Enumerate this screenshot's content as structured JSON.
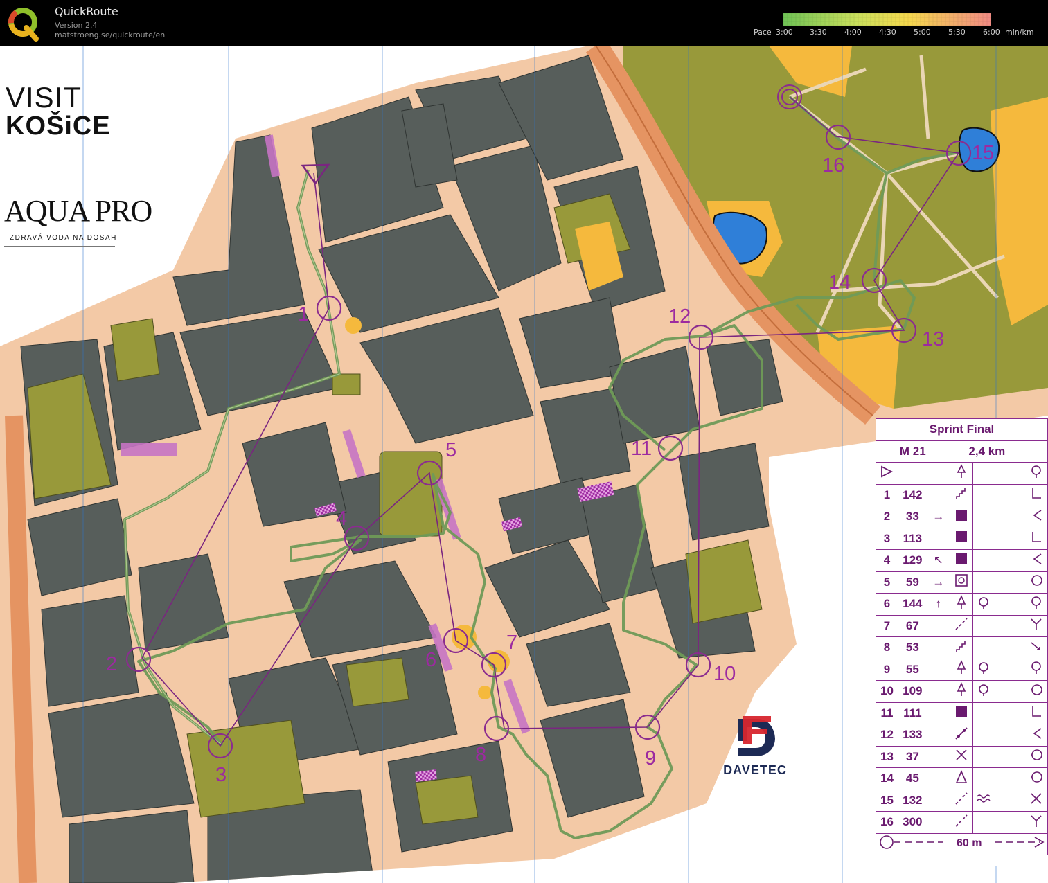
{
  "app": {
    "name": "QuickRoute",
    "version": "Version 2.4",
    "url": "matstroeng.se/quickroute/en"
  },
  "pace_scale": {
    "label": "Pace",
    "ticks": [
      "3:00",
      "3:30",
      "4:00",
      "4:30",
      "5:00",
      "5:30",
      "6:00"
    ],
    "unit": "min/km",
    "colors": [
      "#6fc255",
      "#d9e35c",
      "#f5d84e",
      "#f08a84"
    ]
  },
  "sponsors": {
    "visit_line1": "VISIT",
    "visit_line2": "KOŠiCE",
    "aquapro_name": "AQUA PRO",
    "aquapro_tagline": "ZDRAVÁ VODA NA DOSAH",
    "davetec_name": "DAVETEC"
  },
  "map": {
    "colors": {
      "building": "#575e5b",
      "paved": "#f3c9a6",
      "vegetation": "#98993a",
      "open_yellow": "#f5b93d",
      "water": "#2f7fd8",
      "course": "#8b2c8f",
      "route": "#6f9a57",
      "magnetic_north": "#2c73cc"
    },
    "controls": [
      {
        "label": "1"
      },
      {
        "label": "2"
      },
      {
        "label": "3"
      },
      {
        "label": "4"
      },
      {
        "label": "5"
      },
      {
        "label": "6"
      },
      {
        "label": "7"
      },
      {
        "label": "8"
      },
      {
        "label": "9"
      },
      {
        "label": "10"
      },
      {
        "label": "11"
      },
      {
        "label": "12"
      },
      {
        "label": "13"
      },
      {
        "label": "14"
      },
      {
        "label": "15"
      },
      {
        "label": "16"
      }
    ]
  },
  "control_description": {
    "title": "Sprint Final",
    "class": "M 21",
    "length": "2,4 km",
    "rows": [
      {
        "num": "1",
        "code": "142",
        "dir": "",
        "feature": "stairs-icon",
        "detail": "",
        "loc": "corner-icon"
      },
      {
        "num": "2",
        "code": "33",
        "dir": "→",
        "feature": "building-icon",
        "detail": "",
        "loc": "inner-corner-icon"
      },
      {
        "num": "3",
        "code": "113",
        "dir": "",
        "feature": "building-icon",
        "detail": "",
        "loc": "corner-icon"
      },
      {
        "num": "4",
        "code": "129",
        "dir": "↖",
        "feature": "building-icon",
        "detail": "",
        "loc": "inner-corner-icon"
      },
      {
        "num": "5",
        "code": "59",
        "dir": "→",
        "feature": "flowerbed-icon",
        "detail": "",
        "loc": "side-icon"
      },
      {
        "num": "6",
        "code": "144",
        "dir": "↑",
        "feature": "tree-icon",
        "detail": "bush-icon",
        "loc": "foot-icon"
      },
      {
        "num": "7",
        "code": "67",
        "dir": "",
        "feature": "paved-edge-icon",
        "detail": "",
        "loc": "junction-icon"
      },
      {
        "num": "8",
        "code": "53",
        "dir": "",
        "feature": "stairs-icon",
        "detail": "",
        "loc": "end-icon"
      },
      {
        "num": "9",
        "code": "55",
        "dir": "",
        "feature": "tree-icon",
        "detail": "bush-icon",
        "loc": "foot-icon"
      },
      {
        "num": "10",
        "code": "109",
        "dir": "",
        "feature": "tree-icon",
        "detail": "bush-icon",
        "loc": "side-icon"
      },
      {
        "num": "11",
        "code": "111",
        "dir": "",
        "feature": "building-icon",
        "detail": "",
        "loc": "corner-icon"
      },
      {
        "num": "12",
        "code": "133",
        "dir": "",
        "feature": "wall-icon",
        "detail": "",
        "loc": "inner-corner-icon"
      },
      {
        "num": "13",
        "code": "37",
        "dir": "",
        "feature": "crossing-icon",
        "detail": "",
        "loc": "side-icon"
      },
      {
        "num": "14",
        "code": "45",
        "dir": "",
        "feature": "monument-icon",
        "detail": "",
        "loc": "side-icon"
      },
      {
        "num": "15",
        "code": "132",
        "dir": "",
        "feature": "paved-edge-icon",
        "detail": "water-icon",
        "loc": "crossing-icon"
      },
      {
        "num": "16",
        "code": "300",
        "dir": "",
        "feature": "paved-edge-icon",
        "detail": "",
        "loc": "junction-icon"
      }
    ],
    "finish_distance": "60 m"
  }
}
